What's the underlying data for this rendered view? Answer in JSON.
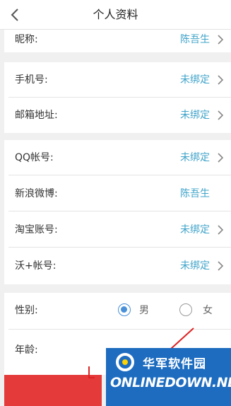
{
  "header": {
    "title": "个人资料"
  },
  "nickname": {
    "label": "昵称:",
    "value": "陈吾生"
  },
  "contact": [
    {
      "label": "手机号:",
      "value": "未绑定"
    },
    {
      "label": "邮箱地址:",
      "value": "未绑定"
    }
  ],
  "accounts": [
    {
      "label": "QQ帐号:",
      "value": "未绑定"
    },
    {
      "label": "新浪微博:",
      "value": "陈吾生"
    },
    {
      "label": "淘宝账号:",
      "value": "未绑定"
    },
    {
      "label": "沃+帐号:",
      "value": "未绑定"
    }
  ],
  "profile": {
    "gender_label": "性别:",
    "gender_options": [
      "男",
      "女"
    ],
    "gender_selected": "男",
    "age_label": "年龄:"
  },
  "watermark": {
    "cn": "华军软件园",
    "en": "ONLINEDOWN.NET"
  },
  "colors": {
    "accent": "#3fa3c9",
    "radio": "#4a90d9",
    "red": "#e53a3a",
    "watermark_bg": "#1d6cc0"
  }
}
